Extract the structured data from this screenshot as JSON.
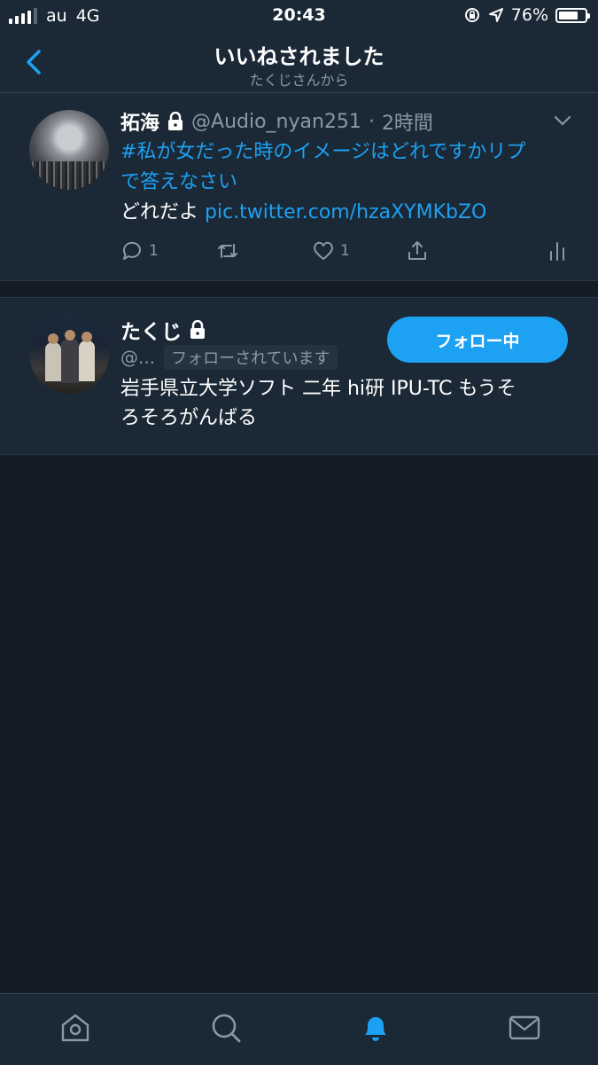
{
  "status_bar": {
    "carrier": "au",
    "network": "4G",
    "time": "20:43",
    "battery_percent_label": "76%",
    "battery_level": 0.76
  },
  "nav": {
    "title": "いいねされました",
    "subtitle": "たくじさんから",
    "back_icon": "chevron-left-icon"
  },
  "tweet": {
    "name": "拓海",
    "protected_icon": "lock-icon",
    "handle": "@Audio_nyan251",
    "separator": "·",
    "time": "2時間",
    "hashtag_line1": "#私が女だった時のイメージはどれですかリプ",
    "hashtag_line2": "で答えなさい",
    "body": "どれだよ",
    "link": "pic.twitter.com/hzaXYMKbZO",
    "reply_count": "1",
    "like_count": "1"
  },
  "user": {
    "name": "たくじ",
    "handle": "@...",
    "follows_you": "フォローされています",
    "follow_button": "フォロー中",
    "bio_line1": "岩手県立大学ソフト 二年 hi研 IPU-TC もうそ",
    "bio_line2": "ろそろがんばる"
  },
  "tab_bar": {
    "items": [
      "home-icon",
      "search-icon",
      "notifications-icon",
      "messages-icon"
    ],
    "active": "notifications-icon"
  },
  "colors": {
    "accent": "#1da1f2",
    "background": "#141d26",
    "surface": "#1b2836",
    "muted_text": "#8899a6"
  }
}
